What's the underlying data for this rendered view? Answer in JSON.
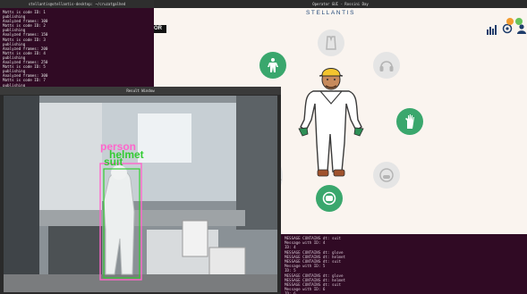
{
  "top_terminal": {
    "title": "stellantis@stellantis-desktop: ~/cruzatgalhed",
    "lines": [
      "Matts is code ID: 1",
      "publishing",
      "Analyzed frames: 100",
      "Matts is code ID: 2",
      "publishing",
      "Analyzed frames: 150",
      "Matts is code ID: 3",
      "publishing",
      "Analyzed frames: 200",
      "Matts is code ID: 4",
      "publishing",
      "Analyzed frames: 250",
      "Matts is code ID: 5",
      "publishing",
      "Analyzed frames: 300",
      "Matts is code ID: 7",
      "publishing",
      "Analyzed frames: 450",
      "Matts is code ID: 8"
    ]
  },
  "operator_app": {
    "window_title": "Operator GUI - Rossini Day",
    "brand": "STELLANTIS",
    "partial_text": "OR",
    "ppe_items": [
      {
        "name": "suit",
        "state": "detected"
      },
      {
        "name": "helmet",
        "state": "not-detected"
      },
      {
        "name": "ear-protection",
        "state": "not-detected"
      },
      {
        "name": "gloves",
        "state": "detected"
      },
      {
        "name": "mask",
        "state": "not-detected"
      },
      {
        "name": "face-shield",
        "state": "detected"
      },
      {
        "name": "boots",
        "state": "not-detected"
      }
    ],
    "colors": {
      "active": "#3aa76d",
      "inactive": "#e5e5e5",
      "brand": "#244a7a"
    }
  },
  "bottom_terminal": {
    "lines": [
      "MESSAGE CONTAINS dt: suit",
      "Message with ID: 4",
      "ID: 4",
      "MESSAGE CONTAINS dt: glove",
      "MESSAGE CONTAINS dt: helmet",
      "MESSAGE CONTAINS dt: suit",
      "Message with ID: 5",
      "ID: 5",
      "MESSAGE CONTAINS dt: glove",
      "MESSAGE CONTAINS dt: helmet",
      "MESSAGE CONTAINS dt: suit",
      "Message with ID: 6",
      "ID: 6",
      "ELEMENTS FALSE NEGATIVE glove = 1",
      "ELEMENTS FALSE NEGATIVE helmet = 1"
    ]
  },
  "result_window": {
    "title": "Result Window",
    "detections": [
      {
        "label": "person",
        "color": "#ff66cc"
      },
      {
        "label": "helmet",
        "color": "#33cc33"
      },
      {
        "label": "suit",
        "color": "#33cc33"
      }
    ]
  }
}
